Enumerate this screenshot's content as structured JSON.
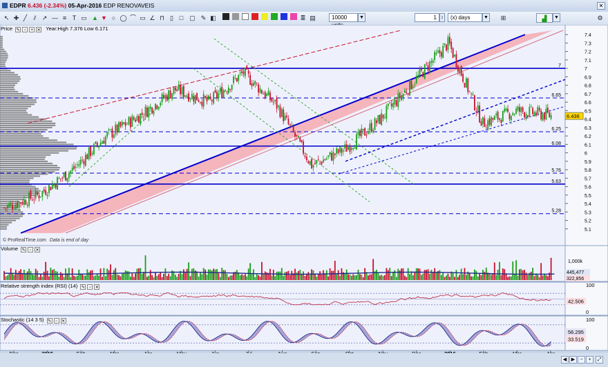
{
  "title": {
    "symbol": "EDPR",
    "price_change": "6.436 (-2.34%)",
    "date": "05-Apr-2016",
    "name": "EDP RENOVAVEIS"
  },
  "toolbar": {
    "units_value": "10000 units",
    "period_value": "1",
    "period_unit": "(x) days"
  },
  "price_panel": {
    "label": "Price",
    "year_info": "Year:High 7.376 Low 6.171",
    "credit": "© ProRealTime.com",
    "credit_note": "Data is end of day",
    "last_price": "6.436"
  },
  "volume_panel": {
    "label": "Volume",
    "axis_label": "1,000k",
    "last_value": "445,477",
    "avg_value": "322,856"
  },
  "rsi_panel": {
    "label": "Relative strength index (RSI) (14)",
    "top_label": "100",
    "bottom_label": "0",
    "last_value": "42.506"
  },
  "stoch_panel": {
    "label": "Stochastic (14 3 5)",
    "top_label": "100",
    "bottom_label": "0",
    "k_value": "56.295",
    "d_value": "33.519"
  },
  "colors": {
    "up": "#1a9e1a",
    "down": "#c8102e",
    "channel_line": "#0000cc",
    "channel_fill": "#f5a0a8",
    "panel_bg": "#eef1fb",
    "rsi_line": "#c0334f",
    "stoch_fill": "#8a85c8"
  },
  "chart_data": {
    "type": "candlestick",
    "instrument": "EDPR",
    "x_ticks": [
      "Dec",
      "2015",
      "Feb",
      "Mar",
      "Apr",
      "May",
      "Jun",
      "Jul",
      "Aug",
      "Sep",
      "Oct",
      "Nov",
      "Dec",
      "2016",
      "Feb",
      "Mar",
      "Apr"
    ],
    "y_ticks": [
      5.1,
      5.2,
      5.3,
      5.4,
      5.5,
      5.6,
      5.7,
      5.8,
      5.9,
      6,
      6.1,
      6.2,
      6.3,
      6.4,
      6.5,
      6.6,
      6.7,
      6.8,
      6.9,
      7,
      7.1,
      7.2,
      7.3,
      7.4
    ],
    "ylim": [
      5.0,
      7.45
    ],
    "horizontal_levels": [
      {
        "value": 7.0,
        "label": "7",
        "style": "solid"
      },
      {
        "value": 6.65,
        "label": "6.65",
        "style": "dashed"
      },
      {
        "value": 6.25,
        "label": "6.25",
        "style": "dashed"
      },
      {
        "value": 6.08,
        "label": "6.08",
        "style": "solid"
      },
      {
        "value": 5.76,
        "label": "5.76",
        "style": "dashed"
      },
      {
        "value": 5.63,
        "label": "5.63",
        "style": "solid"
      },
      {
        "value": 5.28,
        "label": "5.28",
        "style": "dashed"
      }
    ],
    "price_path": [
      {
        "month": "Dec",
        "value": 5.35
      },
      {
        "month": "2015",
        "value": 5.5
      },
      {
        "month": "Feb",
        "value": 5.8
      },
      {
        "month": "Mar",
        "value": 6.2
      },
      {
        "month": "Apr",
        "value": 6.45
      },
      {
        "month": "May",
        "value": 6.75
      },
      {
        "month": "Jun",
        "value": 6.6
      },
      {
        "month": "Jul",
        "value": 6.95
      },
      {
        "month": "Aug",
        "value": 6.55
      },
      {
        "month": "Sep",
        "value": 5.85
      },
      {
        "month": "Oct",
        "value": 6.05
      },
      {
        "month": "Nov",
        "value": 6.4
      },
      {
        "month": "Dec",
        "value": 6.85
      },
      {
        "month": "2016",
        "value": 7.3
      },
      {
        "month": "Feb",
        "value": 6.35
      },
      {
        "month": "Mar",
        "value": 6.5
      },
      {
        "month": "Apr",
        "value": 6.44
      }
    ],
    "rsi": {
      "ylim": [
        0,
        100
      ],
      "last": 42.5
    },
    "stochastic": {
      "ylim": [
        0,
        100
      ],
      "k_last": 56.3,
      "d_last": 33.5
    }
  }
}
